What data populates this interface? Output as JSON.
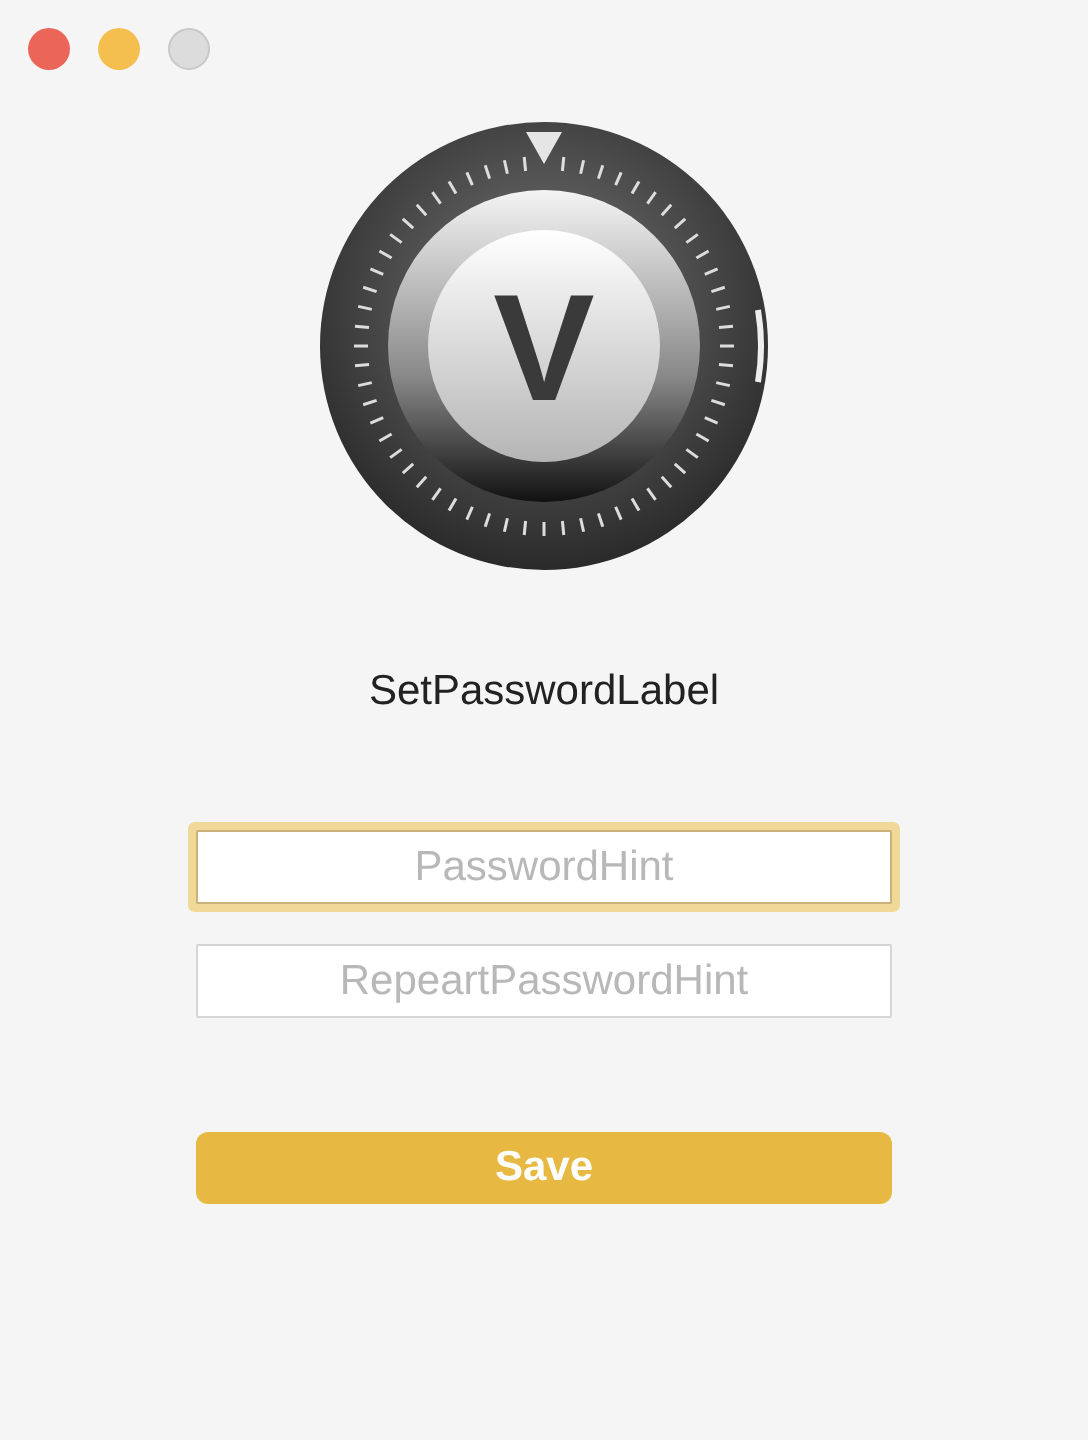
{
  "window": {
    "zoom_disabled": true
  },
  "logo": {
    "letter": "V"
  },
  "title": "SetPasswordLabel",
  "fields": [
    {
      "placeholder": "PasswordHint",
      "focused": true
    },
    {
      "placeholder": "RepeartPasswordHint",
      "focused": false
    }
  ],
  "save_button": {
    "label": "Save"
  }
}
